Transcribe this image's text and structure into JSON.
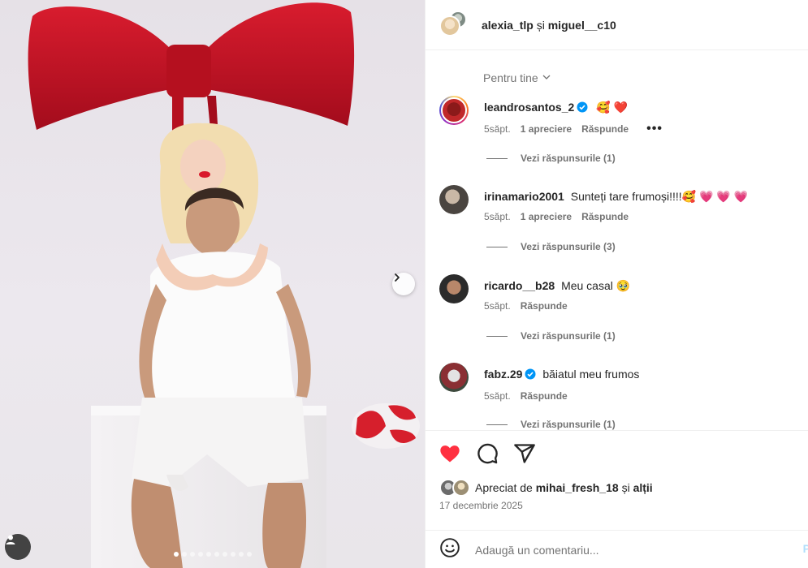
{
  "header": {
    "user1": "alexia_tlp",
    "separator": "și",
    "user2": "miguel__c10"
  },
  "filter": {
    "label": "Pentru tine"
  },
  "comments": [
    {
      "username": "leandrosantos_2",
      "verified": true,
      "text": "🥰 ❤️",
      "time": "5săpt.",
      "likes": "1 apreciere",
      "reply": "Răspunde",
      "more": "•••",
      "replies": "Vezi răspunsurile (1)"
    },
    {
      "username": "irinamario2001",
      "verified": false,
      "text": "Sunteți tare frumoși!!!!🥰 💗 💗 💗",
      "time": "5săpt.",
      "likes": "1 apreciere",
      "reply": "Răspunde",
      "replies": "Vezi răspunsurile (3)"
    },
    {
      "username": "ricardo__b28",
      "verified": false,
      "text": "Meu casal 🥹",
      "time": "5săpt.",
      "reply": "Răspunde",
      "replies": "Vezi răspunsurile (1)"
    },
    {
      "username": "fabz.29",
      "verified": true,
      "text": "băiatul meu frumos",
      "time": "5săpt.",
      "reply": "Răspunde",
      "replies": "Vezi răspunsurile (1)"
    }
  ],
  "actions": {
    "liked_prefix": "Apreciat de",
    "liked_user": "mihai_fresh_18",
    "liked_and": "și",
    "liked_others": "alții",
    "date": "17 decembrie 2025"
  },
  "composer": {
    "placeholder": "Adaugă un comentariu...",
    "post_label": "P"
  },
  "carousel": {
    "slides": 10,
    "active_index": 0
  },
  "colors": {
    "like_red": "#ff3040",
    "verified_blue": "#0095f6",
    "muted_text": "#737373",
    "bow_red": "#c8102e"
  },
  "icons": [
    "heart-icon",
    "comment-icon",
    "share-icon",
    "emoji-icon",
    "chevron-right-icon",
    "user-tag-icon",
    "verified-icon",
    "chevron-down-icon"
  ]
}
